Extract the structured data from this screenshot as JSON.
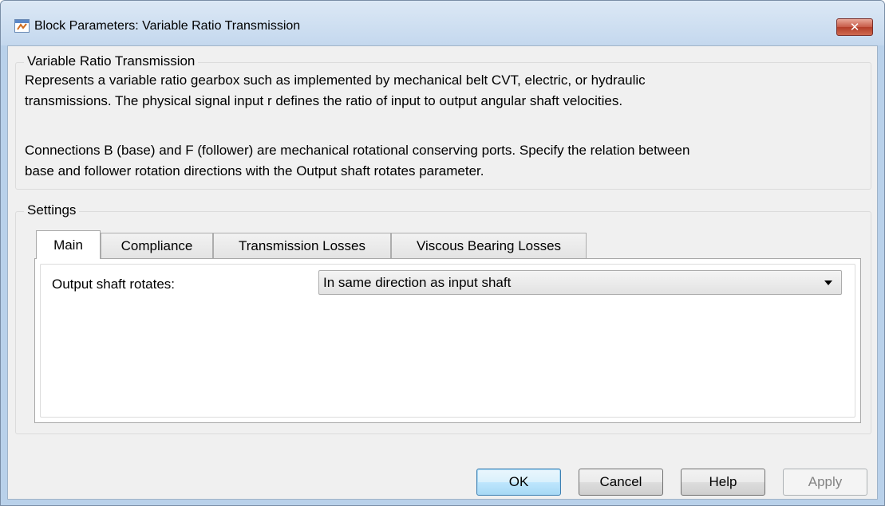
{
  "window": {
    "title": "Block Parameters: Variable Ratio Transmission",
    "close_icon": "close-x-icon",
    "close_color": "#c75a48"
  },
  "description_group": {
    "label": "Variable Ratio Transmission",
    "paragraph1_line1": "Represents a variable ratio gearbox such as implemented by mechanical belt CVT, electric, or hydraulic",
    "paragraph1_line2": "transmissions. The physical signal input r defines the ratio of input to output angular shaft velocities.",
    "paragraph2_line1": "Connections B (base) and F (follower) are mechanical rotational conserving ports. Specify the relation between",
    "paragraph2_line2": "base and follower rotation directions with the Output shaft rotates parameter."
  },
  "settings": {
    "label": "Settings",
    "tabs": [
      {
        "label": "Main",
        "active": true
      },
      {
        "label": "Compliance",
        "active": false
      },
      {
        "label": "Transmission Losses",
        "active": false
      },
      {
        "label": "Viscous Bearing Losses",
        "active": false
      }
    ],
    "main": {
      "output_shaft_label": "Output shaft rotates:",
      "output_shaft_value": "In same direction as input shaft"
    }
  },
  "buttons": {
    "ok": "OK",
    "cancel": "Cancel",
    "help": "Help",
    "apply": "Apply"
  }
}
